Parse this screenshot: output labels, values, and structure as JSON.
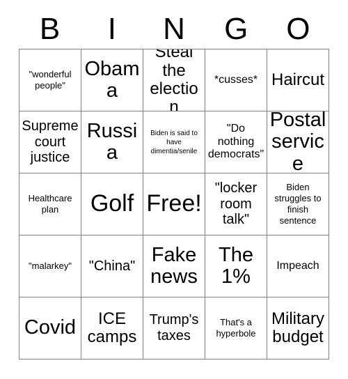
{
  "card": {
    "header_letters": [
      "B",
      "I",
      "N",
      "G",
      "O"
    ],
    "free_space_label": "Free!",
    "rows": [
      [
        {
          "text": "\"wonderful people\"",
          "size": "sz-s"
        },
        {
          "text": "Obama",
          "size": "sz-xxl"
        },
        {
          "text": "Steal the election",
          "size": "sz-xl"
        },
        {
          "text": "*cusses*",
          "size": "sz-m"
        },
        {
          "text": "Haircut",
          "size": "sz-xl"
        }
      ],
      [
        {
          "text": "Supreme court justice",
          "size": "sz-l"
        },
        {
          "text": "Russia",
          "size": "sz-xxl"
        },
        {
          "text": "Biden is said to have dimentia/senile",
          "size": "sz-xs"
        },
        {
          "text": "\"Do nothing democrats\"",
          "size": "sz-m"
        },
        {
          "text": "Postal service",
          "size": "sz-xxl"
        }
      ],
      [
        {
          "text": "Healthcare plan",
          "size": "sz-s"
        },
        {
          "text": "Golf",
          "size": "sz-hu"
        },
        {
          "text": "Free!",
          "size": "sz-hu"
        },
        {
          "text": "\"locker room talk\"",
          "size": "sz-l"
        },
        {
          "text": "Biden struggles to finish sentence",
          "size": "sz-s"
        }
      ],
      [
        {
          "text": "\"malarkey\"",
          "size": "sz-s"
        },
        {
          "text": "\"China\"",
          "size": "sz-l"
        },
        {
          "text": "Fake news",
          "size": "sz-xxl"
        },
        {
          "text": "The 1%",
          "size": "sz-xxl"
        },
        {
          "text": "Impeach",
          "size": "sz-m"
        }
      ],
      [
        {
          "text": "Covid",
          "size": "sz-xxl"
        },
        {
          "text": "ICE camps",
          "size": "sz-xl"
        },
        {
          "text": "Trump's taxes",
          "size": "sz-l"
        },
        {
          "text": "That's a hyperbole",
          "size": "sz-s"
        },
        {
          "text": "Military budget",
          "size": "sz-xl"
        }
      ]
    ]
  },
  "colors": {
    "background": "#ffffff",
    "text": "#000000",
    "grid_line": "#808080"
  }
}
